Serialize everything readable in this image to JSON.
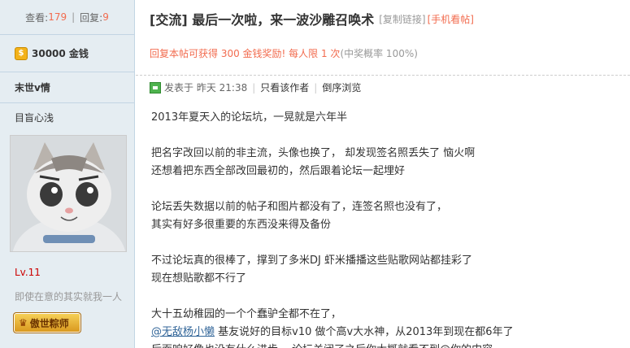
{
  "stats": {
    "views_label": "查看:",
    "views": "179",
    "sep": "|",
    "replies_label": "回复:",
    "replies": "9"
  },
  "gold": {
    "icon": "gold-coin-icon",
    "text": "30000 金钱"
  },
  "user": {
    "name": "末世v情",
    "title": "目盲心浅",
    "level": "Lv.11",
    "signature": "即使在意的其实就我一人",
    "medal": "傲世粽师"
  },
  "thread": {
    "title": "[交流] 最后一次啦，来一波沙雕召唤术",
    "copy_link": "[复制链接]",
    "mobile_view": "[手机看帖]",
    "reward": "回复本帖可获得 300 金钱奖励! 每人限 1 次",
    "reward_odds": "(中奖概率 100%)"
  },
  "post_meta": {
    "posted": "发表于 昨天 21:38",
    "pipe": "|",
    "only_author": "只看该作者",
    "reverse": "倒序浏览"
  },
  "content": {
    "l1": "2013年夏天入的论坛坑，一晃就是六年半",
    "l2": "把名字改回以前的非主流，头像也换了，  却发现签名照丢失了  恼火啊",
    "l3": "还想着把东西全部改回最初的，然后跟着论坛一起埋好",
    "l4": "论坛丢失数据以前的帖子和图片都没有了，连签名照也没有了，",
    "l5": "其实有好多很重要的东西没来得及备份",
    "l6": "不过论坛真的很棒了，撑到了多米DJ 虾米播播这些贴歌网站都挂彩了",
    "l7": "现在想贴歌都不行了",
    "l8": "大十五幼稚园的一个个蠢驴全都不在了，",
    "l9_at": "@无敌杨小懒",
    "l9": "  基友说好的目标v10  做个高v大水神，从2013年到现在都6年了",
    "l10": "后面咱好像也没有什么进步，  论坛关闭了之后你大概就看不到@你的内容"
  }
}
